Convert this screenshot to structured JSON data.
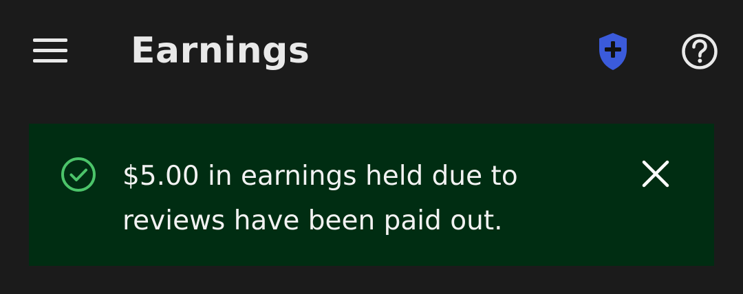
{
  "header": {
    "title": "Earnings",
    "menu_icon": "hamburger-menu-icon",
    "safety_icon": "shield-plus-icon",
    "help_icon": "question-circle-icon"
  },
  "banner": {
    "message": "$5.00 in earnings held due to reviews have been paid out.",
    "status_icon": "check-circle-icon",
    "close_icon": "close-icon"
  },
  "colors": {
    "background": "#1b1b1b",
    "banner_background": "#002d12",
    "success_green": "#4cc46a",
    "safety_blue": "#3b5bdb",
    "text_primary": "#e9e9e9"
  }
}
